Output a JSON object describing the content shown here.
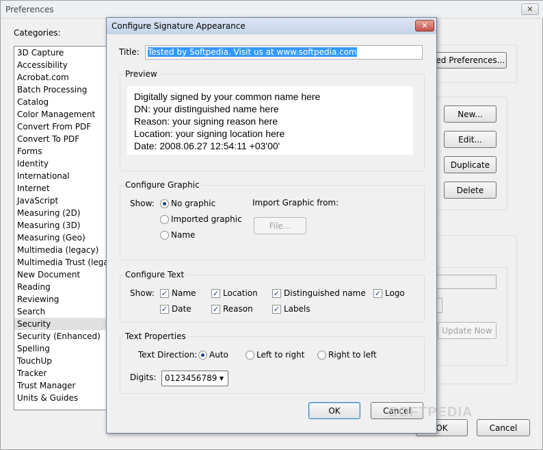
{
  "preferences": {
    "title": "Preferences",
    "close_label": "✕",
    "categories_label": "Categories:",
    "selected_category": "Security",
    "categories": [
      "3D Capture",
      "Accessibility",
      "Acrobat.com",
      "Batch Processing",
      "Catalog",
      "Color Management",
      "Convert From PDF",
      "Convert To PDF",
      "Forms",
      "Identity",
      "International",
      "Internet",
      "JavaScript",
      "Measuring (2D)",
      "Measuring (3D)",
      "Measuring (Geo)",
      "Multimedia (legacy)",
      "Multimedia Trust (legacy)",
      "New Document",
      "Reading",
      "Reviewing",
      "Search",
      "Security",
      "Security (Enhanced)",
      "Spelling",
      "TouchUp",
      "Tracker",
      "Trust Manager",
      "Units & Guides"
    ],
    "advanced_preferences_label": "ced Preferences...",
    "new_label": "New...",
    "edit_label": "Edit...",
    "duplicate_label": "Duplicate",
    "delete_label": "Delete",
    "update_now_label": "Update Now",
    "ok_label": "OK",
    "cancel_label": "Cancel"
  },
  "dialog": {
    "title": "Configure Signature Appearance",
    "close_label": "✕",
    "title_label": "Title:",
    "title_value": "Tested by Softpedia. Visit us at www.softpedia.com",
    "preview_legend": "Preview",
    "preview_lines": [
      "Digitally signed by your common name here",
      "DN: your distinguished name here",
      "Reason: your signing reason here",
      "Location: your signing location here",
      "Date: 2008.06.27 12:54:11 +03'00'"
    ],
    "configure_graphic": {
      "legend": "Configure Graphic",
      "show_label": "Show:",
      "options": [
        "No graphic",
        "Imported graphic",
        "Name"
      ],
      "selected": "No graphic",
      "import_label": "Import Graphic from:",
      "file_label": "File..."
    },
    "configure_text": {
      "legend": "Configure Text",
      "show_label": "Show:",
      "checkboxes": [
        {
          "label": "Name",
          "checked": true
        },
        {
          "label": "Location",
          "checked": true
        },
        {
          "label": "Distinguished name",
          "checked": true
        },
        {
          "label": "Logo",
          "checked": true
        },
        {
          "label": "Date",
          "checked": true
        },
        {
          "label": "Reason",
          "checked": true
        },
        {
          "label": "Labels",
          "checked": true
        }
      ]
    },
    "text_properties": {
      "legend": "Text Properties",
      "direction_label": "Text Direction:",
      "directions": [
        "Auto",
        "Left to right",
        "Right to left"
      ],
      "selected_direction": "Auto",
      "digits_label": "Digits:",
      "digits_value": "0123456789"
    },
    "ok_label": "OK",
    "cancel_label": "Cancel"
  },
  "watermark": "SOFTPEDIA",
  "colors": {
    "selection": "#3399ff",
    "window_bg": "#f0f0f0",
    "close_red": "#c75050"
  }
}
